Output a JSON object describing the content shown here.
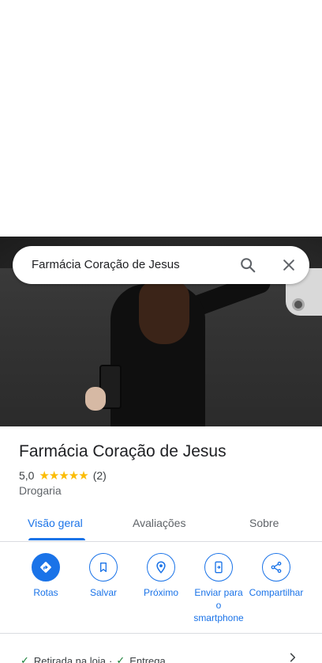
{
  "search": {
    "query": "Farmácia Coração de Jesus"
  },
  "place": {
    "name": "Farmácia Coração de Jesus",
    "rating": "5,0",
    "stars": "★★★★★",
    "review_count": "(2)",
    "category": "Drogaria"
  },
  "tabs": [
    {
      "label": "Visão geral",
      "active": true
    },
    {
      "label": "Avaliações",
      "active": false
    },
    {
      "label": "Sobre",
      "active": false
    }
  ],
  "actions": [
    {
      "label": "Rotas",
      "icon": "directions-icon"
    },
    {
      "label": "Salvar",
      "icon": "bookmark-icon"
    },
    {
      "label": "Próximo",
      "icon": "nearby-icon"
    },
    {
      "label": "Enviar para o smartphone",
      "icon": "send-to-phone-icon"
    },
    {
      "label": "Compartilhar",
      "icon": "share-icon"
    }
  ],
  "services": {
    "item1": "Retirada na loja",
    "separator": "·",
    "item2": "Entrega"
  },
  "colors": {
    "accent": "#1a73e8",
    "star": "#fbbc04",
    "check": "#188038"
  }
}
